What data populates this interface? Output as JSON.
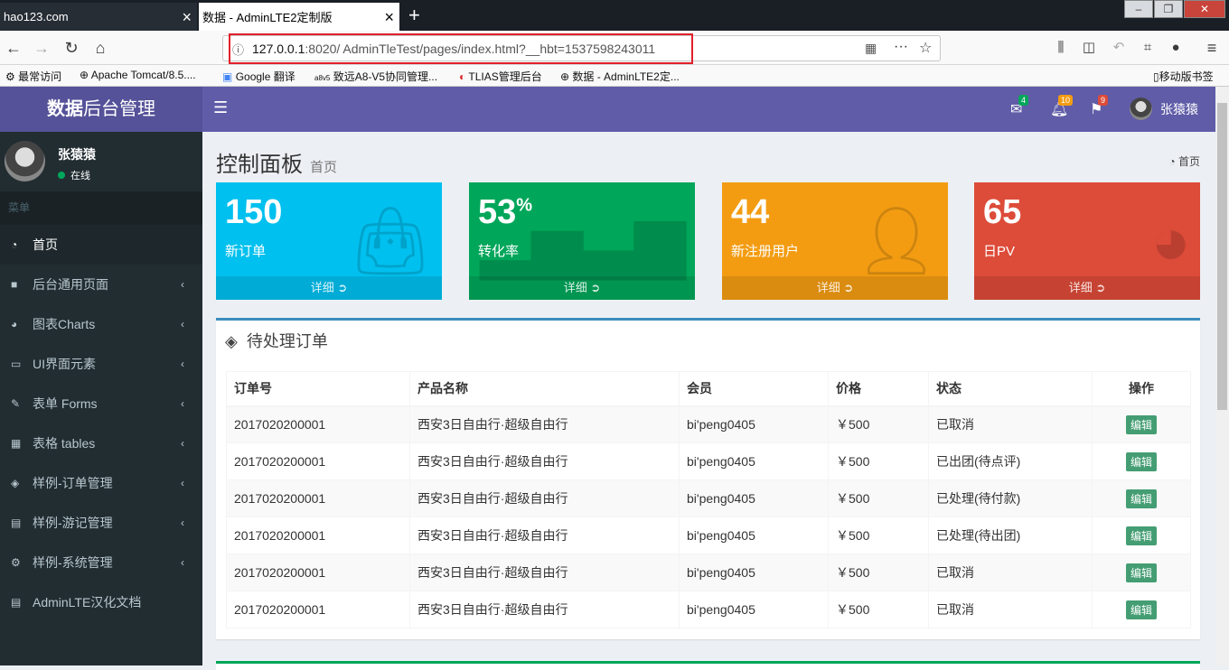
{
  "browser": {
    "tabs": [
      {
        "label": "hao123.com"
      },
      {
        "label": "数据 - AdminLTE2定制版"
      }
    ],
    "url_host": "127.0.0.1",
    "url_rest": ":8020/ AdminTleTest/pages/index.html?__hbt=1537598243011",
    "bookmarks": [
      "最常访问",
      "Apache Tomcat/8.5....",
      "Google 翻译",
      "致远A8-V5协同管理...",
      "TLIAS管理后台",
      "数据 - AdminLTE2定...",
      "移动版书签"
    ]
  },
  "header": {
    "logo_bold": "数据",
    "logo_rest": "后台管理",
    "mail_count": "4",
    "bell_count": "10",
    "flag_count": "9",
    "user": "张猿猿"
  },
  "sidebar": {
    "user": "张猿猿",
    "status": "在线",
    "menu_header": "菜单",
    "items": [
      {
        "label": "首页",
        "icon": "dashboard-icon"
      },
      {
        "label": "后台通用页面",
        "icon": "folder-icon"
      },
      {
        "label": "图表Charts",
        "icon": "pie-chart-icon"
      },
      {
        "label": "UI界面元素",
        "icon": "laptop-icon"
      },
      {
        "label": "表单 Forms",
        "icon": "edit-icon"
      },
      {
        "label": "表格 tables",
        "icon": "table-icon"
      },
      {
        "label": "样例-订单管理",
        "icon": "cube-icon"
      },
      {
        "label": "样例-游记管理",
        "icon": "book-icon"
      },
      {
        "label": "样例-系统管理",
        "icon": "cogs-icon"
      },
      {
        "label": "AdminLTE汉化文档",
        "icon": "book-icon"
      }
    ]
  },
  "content": {
    "title": "控制面板",
    "subtitle": "首页",
    "breadcrumb": "首页",
    "boxes": [
      {
        "num": "150",
        "sup": "",
        "label": "新订单",
        "more": "详细",
        "color": "#00c0ef"
      },
      {
        "num": "53",
        "sup": "%",
        "label": "转化率",
        "more": "详细",
        "color": "#00a65a"
      },
      {
        "num": "44",
        "sup": "",
        "label": "新注册用户",
        "more": "详细",
        "color": "#f39c12"
      },
      {
        "num": "65",
        "sup": "",
        "label": "日PV",
        "more": "详细",
        "color": "#dd4b39"
      }
    ],
    "orders": {
      "title": "待处理订单",
      "headers": [
        "订单号",
        "产品名称",
        "会员",
        "价格",
        "状态",
        "操作"
      ],
      "rows": [
        [
          "2017020200001",
          "西安3日自由行·超级自由行",
          "bi'peng0405",
          "￥500",
          "已取消",
          "编辑"
        ],
        [
          "2017020200001",
          "西安3日自由行·超级自由行",
          "bi'peng0405",
          "￥500",
          "已出团(待点评)",
          "编辑"
        ],
        [
          "2017020200001",
          "西安3日自由行·超级自由行",
          "bi'peng0405",
          "￥500",
          "已处理(待付款)",
          "编辑"
        ],
        [
          "2017020200001",
          "西安3日自由行·超级自由行",
          "bi'peng0405",
          "￥500",
          "已处理(待出团)",
          "编辑"
        ],
        [
          "2017020200001",
          "西安3日自由行·超级自由行",
          "bi'peng0405",
          "￥500",
          "已取消",
          "编辑"
        ],
        [
          "2017020200001",
          "西安3日自由行·超级自由行",
          "bi'peng0405",
          "￥500",
          "已取消",
          "编辑"
        ]
      ]
    }
  }
}
